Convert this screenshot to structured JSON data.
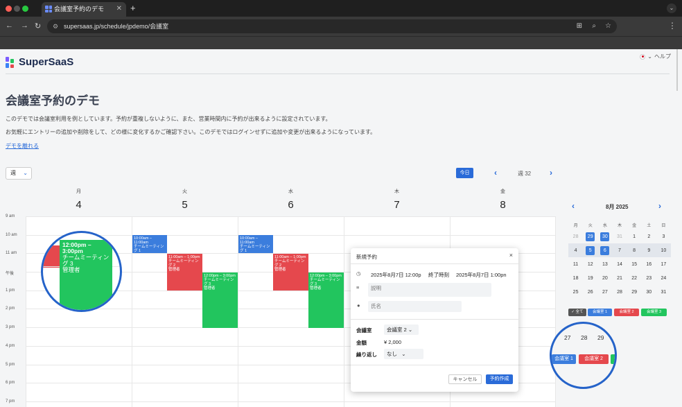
{
  "browser": {
    "tab_title": "会議室予約のデモ",
    "close": "✕",
    "new_tab": "+",
    "url": "supersaas.jp/schedule/jpdemo/会議室"
  },
  "header": {
    "logo_text": "SuperSaaS",
    "help": "ヘルプ"
  },
  "page": {
    "title": "会議室予約のデモ",
    "desc1": "このデモでは会議室利用を例としています。予約が重複しないように、また、営業時間内に予約が出来るように設定されています。",
    "desc2": "お気軽にエントリーの追加や削除をして、どの様に変化するかご確認下さい。このデモではログインせずに追加や変更が出来るようになっています。",
    "link": "デモを離れる"
  },
  "toolbar": {
    "view": "週",
    "today": "今日",
    "week_label": "週 32"
  },
  "days": [
    {
      "wd": "月",
      "dn": "4"
    },
    {
      "wd": "火",
      "dn": "5"
    },
    {
      "wd": "水",
      "dn": "6"
    },
    {
      "wd": "木",
      "dn": "7"
    },
    {
      "wd": "金",
      "dn": "8"
    }
  ],
  "times": [
    "9 am",
    "10 am",
    "11 am",
    "午後",
    "1 pm",
    "2 pm",
    "3 pm",
    "4 pm",
    "5 pm",
    "6 pm",
    "7 pm"
  ],
  "events": {
    "e1": {
      "time": "10:00am – 11:00am",
      "title": "チームミーティング 1"
    },
    "e2": {
      "time": "11:00am – 1:00pm",
      "title": "チームミーティング 2",
      "who": "管理者"
    },
    "e3": {
      "time": "12:00pm – 3:00pm",
      "title": "チームミーティング 3",
      "who": "管理者"
    }
  },
  "magnifier": {
    "time": "12:00pm – 3:00pm",
    "title": "チームミーティング 3",
    "who": "管理者"
  },
  "dialog": {
    "title": "新規予約",
    "close": "×",
    "start": "2025年8月7日 12:00p",
    "end_label": "終了時刻",
    "end": "2025年8月7日 1:00pn",
    "desc_placeholder": "説明",
    "name_placeholder": "氏名",
    "room_label": "会議室",
    "room_value": "会議室 2",
    "price_label": "金額",
    "price_value": "¥ 2,000",
    "repeat_label": "繰り返し",
    "repeat_value": "なし",
    "cancel": "キャンセル",
    "create": "予約作成"
  },
  "mini_calendar": {
    "title": "8月 2025",
    "headers": [
      "月",
      "火",
      "水",
      "木",
      "金",
      "土",
      "日"
    ],
    "weeks": [
      [
        "28",
        "29",
        "30",
        "31",
        "1",
        "2",
        "3"
      ],
      [
        "4",
        "5",
        "6",
        "7",
        "8",
        "9",
        "10"
      ],
      [
        "11",
        "12",
        "13",
        "14",
        "15",
        "16",
        "17"
      ],
      [
        "18",
        "19",
        "20",
        "21",
        "22",
        "23",
        "24"
      ],
      [
        "25",
        "26",
        "27",
        "28",
        "29",
        "30",
        "31"
      ]
    ]
  },
  "filters": {
    "all": "✓ 全て",
    "room1": "会議室 1",
    "room2": "会議室 2",
    "room3": "会議室 3"
  },
  "magnifier2": {
    "d1": "27",
    "d2": "28",
    "d3": "29",
    "room1": "会議室 1",
    "room2": "会議室 2"
  },
  "colors": {
    "blue": "#3b7ddd",
    "red": "#e5484d",
    "green": "#22c55e",
    "accent": "#2a6bd8"
  }
}
